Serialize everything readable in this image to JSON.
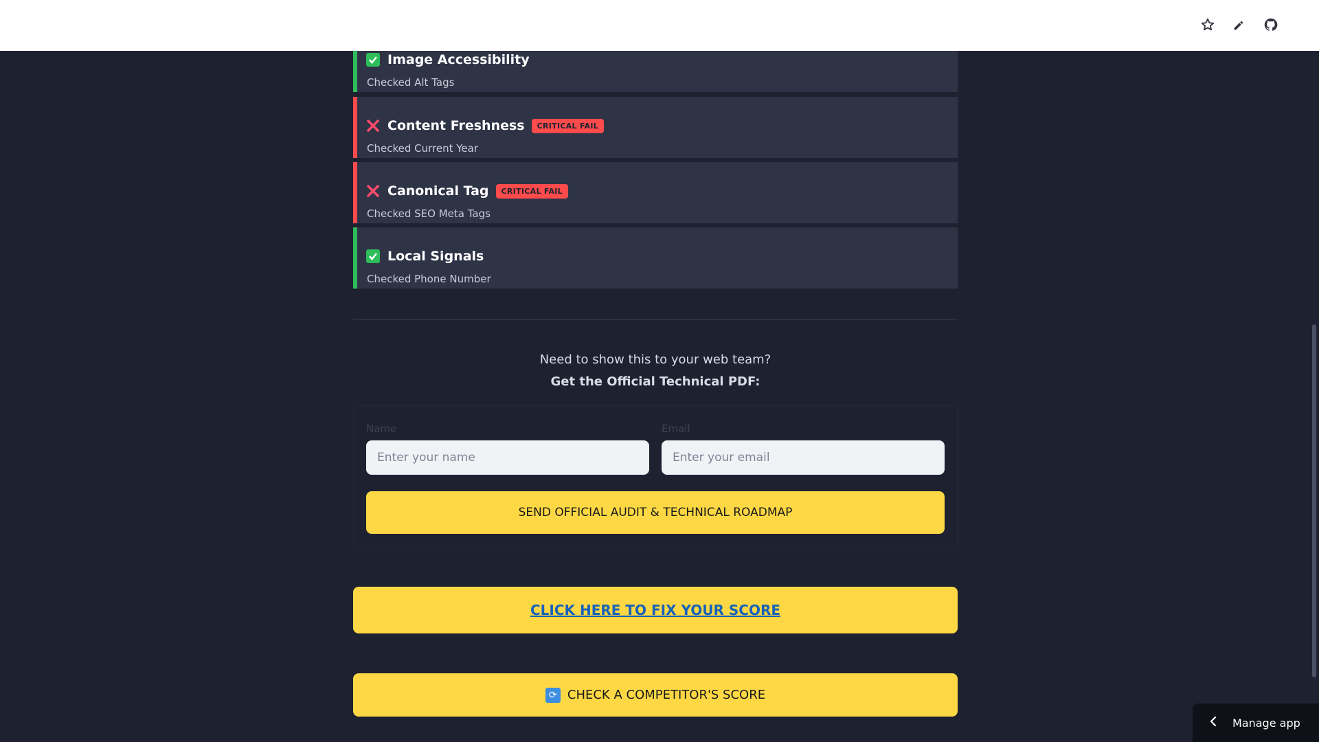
{
  "checks": [
    {
      "title": "Image Accessibility",
      "subtitle": "Checked Alt Tags",
      "status": "pass",
      "badge": ""
    },
    {
      "title": "Content Freshness",
      "subtitle": "Checked Current Year",
      "status": "fail",
      "badge": "CRITICAL FAIL"
    },
    {
      "title": "Canonical Tag",
      "subtitle": "Checked SEO Meta Tags",
      "status": "fail",
      "badge": "CRITICAL FAIL"
    },
    {
      "title": "Local Signals",
      "subtitle": "Checked Phone Number",
      "status": "pass",
      "badge": ""
    }
  ],
  "pdf": {
    "line1": "Need to show this to your web team?",
    "line2": "Get the Official Technical PDF:"
  },
  "form": {
    "name_label": "Name",
    "name_placeholder": "Enter your name",
    "email_label": "Email",
    "email_placeholder": "Enter your email",
    "submit_label": "SEND OFFICIAL AUDIT & TECHNICAL ROADMAP"
  },
  "cta": {
    "fix_label": "CLICK HERE TO FIX YOUR SCORE",
    "competitor_label": "CHECK A COMPETITOR'S SCORE"
  },
  "footer": {
    "manage_app": "Manage app"
  },
  "icons": {
    "star": "star-icon",
    "edit": "pencil-icon",
    "github": "github-icon"
  },
  "colors": {
    "pass": "#2ebd59",
    "fail": "#ff4b4b",
    "accent": "#fdd844",
    "card": "#2f3346",
    "background": "#1e2130"
  }
}
